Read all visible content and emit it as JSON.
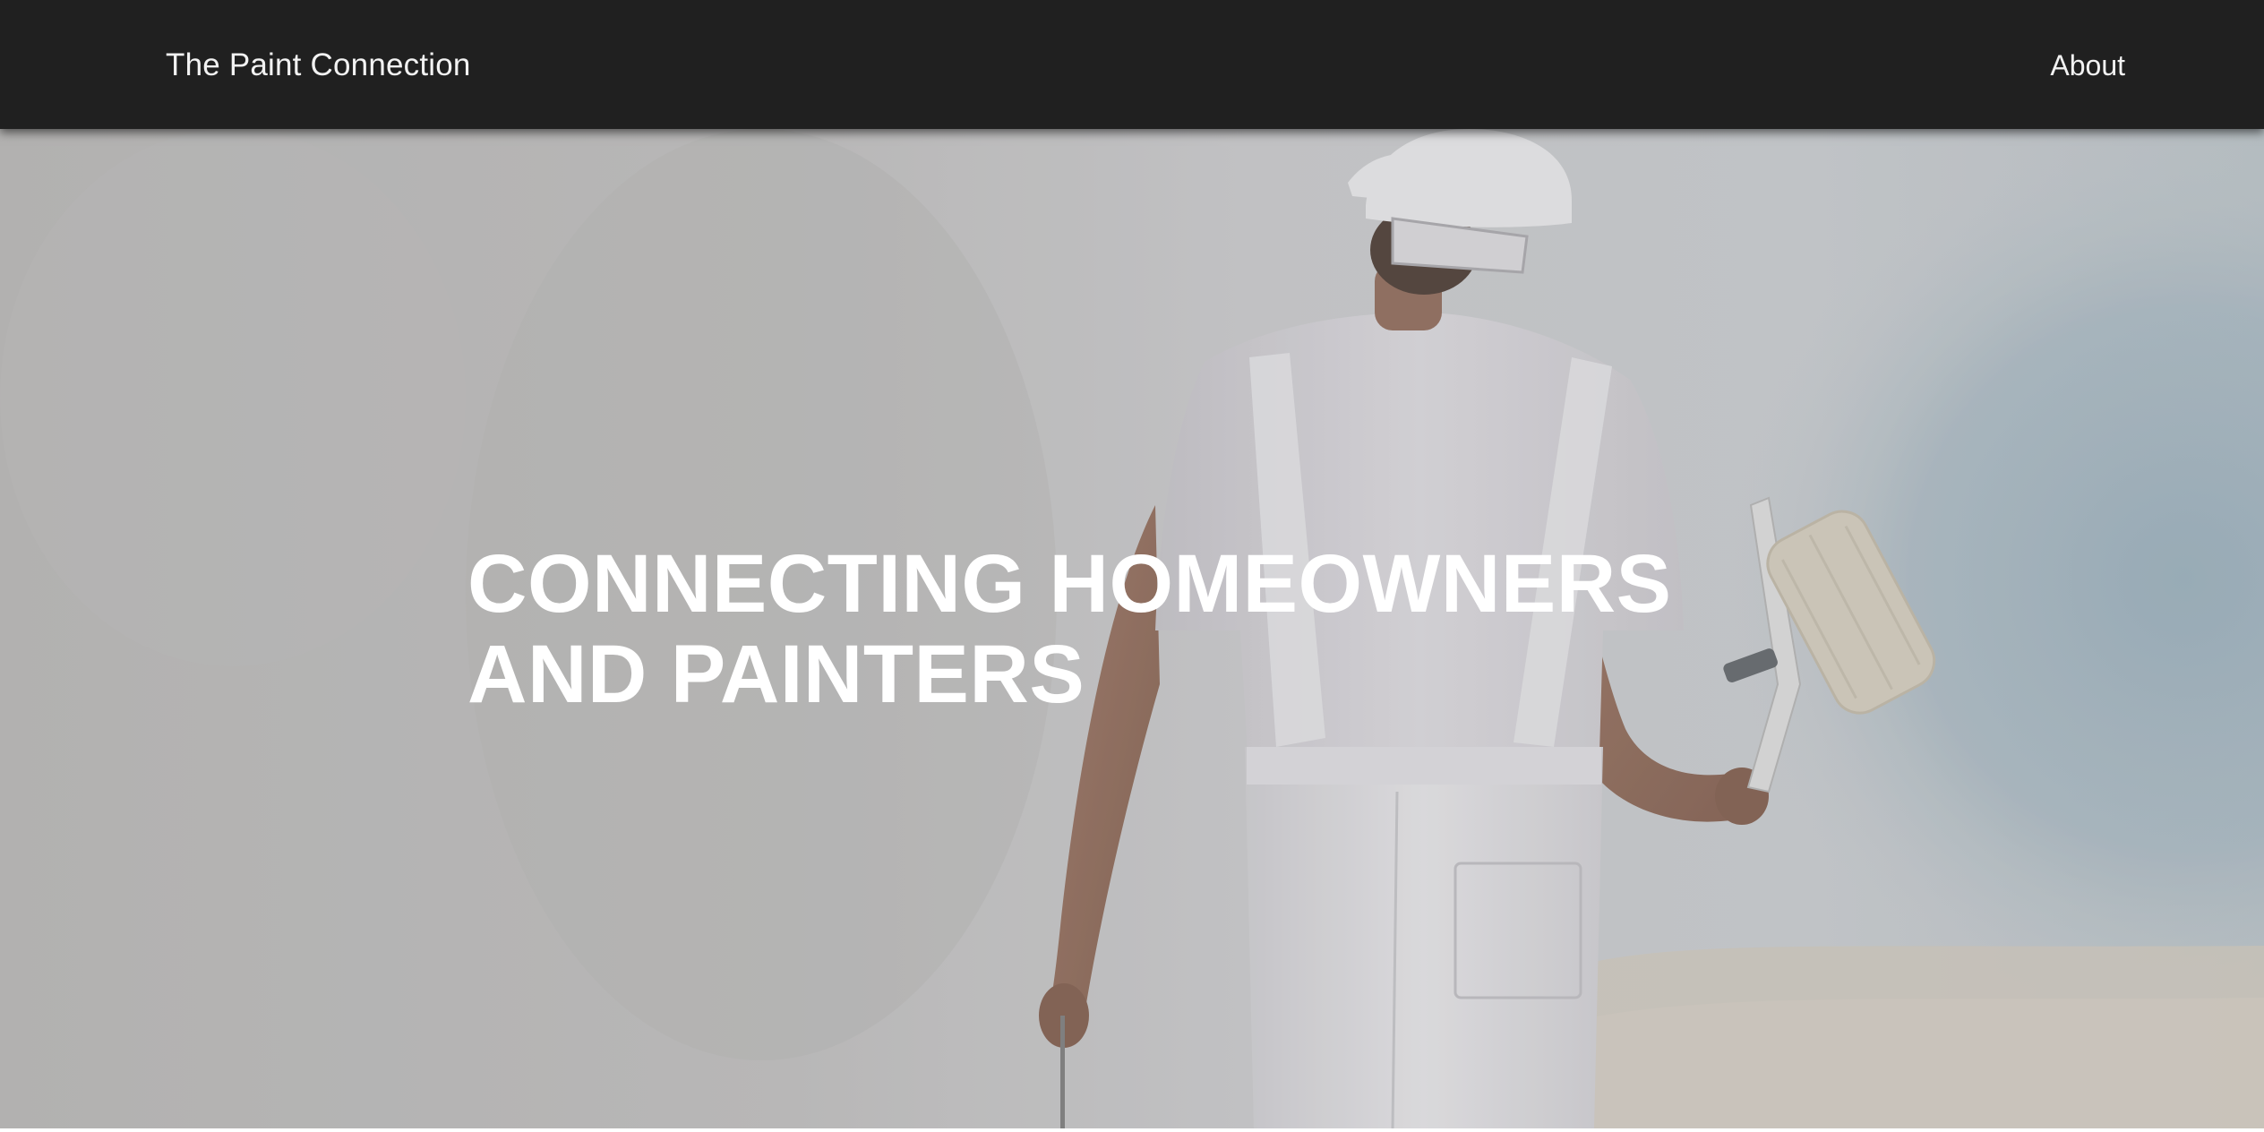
{
  "header": {
    "site_title": "The Paint Connection",
    "nav": {
      "about_label": "About"
    }
  },
  "hero": {
    "title_line_1": "CONNECTING HOMEOWNERS",
    "title_line_2": "AND PAINTERS",
    "image_description_icon": "painter-with-roller-photo"
  },
  "colors": {
    "header_bg": "#202020",
    "header_text": "#f2f2f2",
    "hero_text": "#ffffff",
    "wall_gray": "#c4c3c2",
    "wall_blue": "#a9bac4"
  }
}
